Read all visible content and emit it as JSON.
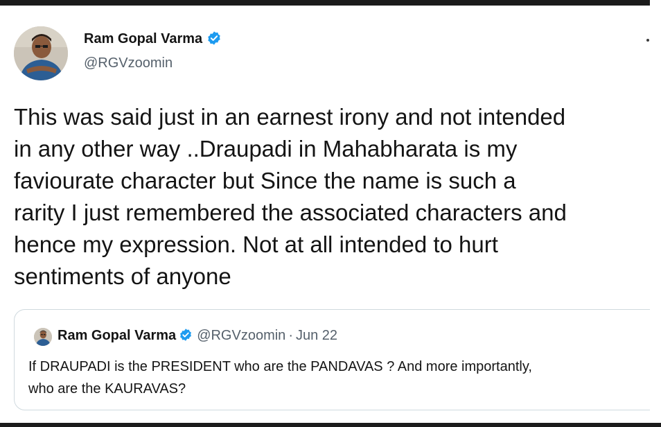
{
  "tweet": {
    "author": {
      "name": "Ram Gopal Varma",
      "handle": "@RGVzoomin",
      "verified": true
    },
    "text_lines": [
      "This was said just in an earnest irony and not intended",
      "in any other way ..Draupadi in Mahabharata is my",
      "faviourate character but Since the name is such a",
      "rarity I just remembered the associated characters and",
      "hence my expression. Not at all intended to hurt",
      "sentiments of anyone"
    ]
  },
  "quoted_tweet": {
    "author": {
      "name": "Ram Gopal Varma",
      "handle": "@RGVzoomin",
      "verified": true
    },
    "separator": "·",
    "date": "Jun 22",
    "text_lines": [
      "If DRAUPADI is the PRESIDENT who are the PANDAVAS ? And more importantly,",
      "who are the KAURAVAS?"
    ]
  },
  "colors": {
    "verified_blue": "#1d9bf0",
    "text": "#141414",
    "secondary_text": "#55606b",
    "border": "#cfd9de"
  },
  "icons": {
    "verified": "verified-badge-icon",
    "more": "more-options-icon"
  }
}
